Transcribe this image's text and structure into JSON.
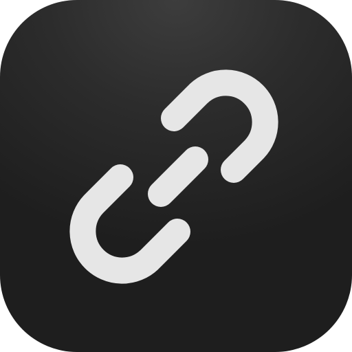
{
  "icon": {
    "name": "link-icon",
    "background_color": "#2a2a2a",
    "glyph_color": "#e6e6e6"
  }
}
